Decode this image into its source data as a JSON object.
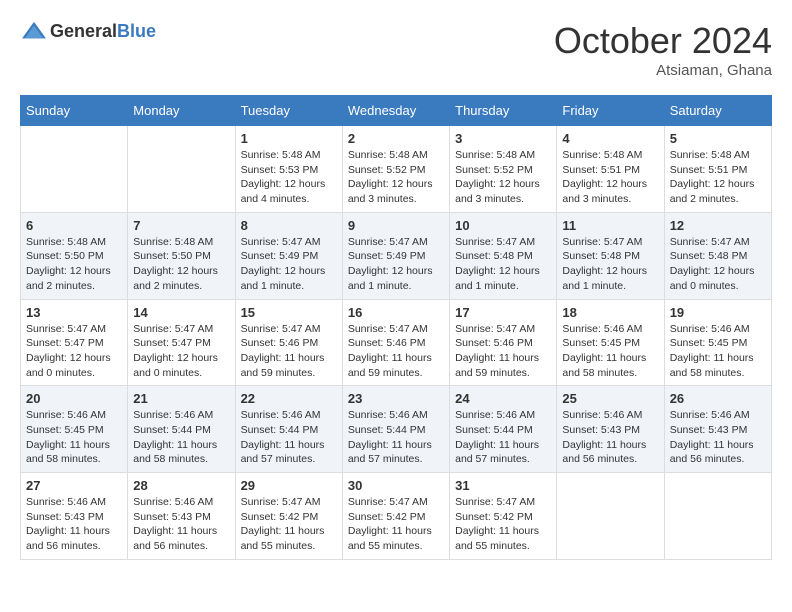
{
  "header": {
    "logo_general": "General",
    "logo_blue": "Blue",
    "month": "October 2024",
    "location": "Atsiaman, Ghana"
  },
  "weekdays": [
    "Sunday",
    "Monday",
    "Tuesday",
    "Wednesday",
    "Thursday",
    "Friday",
    "Saturday"
  ],
  "weeks": [
    [
      {
        "day": "",
        "info": ""
      },
      {
        "day": "",
        "info": ""
      },
      {
        "day": "1",
        "sunrise": "5:48 AM",
        "sunset": "5:53 PM",
        "daylight": "12 hours and 4 minutes."
      },
      {
        "day": "2",
        "sunrise": "5:48 AM",
        "sunset": "5:52 PM",
        "daylight": "12 hours and 3 minutes."
      },
      {
        "day": "3",
        "sunrise": "5:48 AM",
        "sunset": "5:52 PM",
        "daylight": "12 hours and 3 minutes."
      },
      {
        "day": "4",
        "sunrise": "5:48 AM",
        "sunset": "5:51 PM",
        "daylight": "12 hours and 3 minutes."
      },
      {
        "day": "5",
        "sunrise": "5:48 AM",
        "sunset": "5:51 PM",
        "daylight": "12 hours and 2 minutes."
      }
    ],
    [
      {
        "day": "6",
        "sunrise": "5:48 AM",
        "sunset": "5:50 PM",
        "daylight": "12 hours and 2 minutes."
      },
      {
        "day": "7",
        "sunrise": "5:48 AM",
        "sunset": "5:50 PM",
        "daylight": "12 hours and 2 minutes."
      },
      {
        "day": "8",
        "sunrise": "5:47 AM",
        "sunset": "5:49 PM",
        "daylight": "12 hours and 1 minute."
      },
      {
        "day": "9",
        "sunrise": "5:47 AM",
        "sunset": "5:49 PM",
        "daylight": "12 hours and 1 minute."
      },
      {
        "day": "10",
        "sunrise": "5:47 AM",
        "sunset": "5:48 PM",
        "daylight": "12 hours and 1 minute."
      },
      {
        "day": "11",
        "sunrise": "5:47 AM",
        "sunset": "5:48 PM",
        "daylight": "12 hours and 1 minute."
      },
      {
        "day": "12",
        "sunrise": "5:47 AM",
        "sunset": "5:48 PM",
        "daylight": "12 hours and 0 minutes."
      }
    ],
    [
      {
        "day": "13",
        "sunrise": "5:47 AM",
        "sunset": "5:47 PM",
        "daylight": "12 hours and 0 minutes."
      },
      {
        "day": "14",
        "sunrise": "5:47 AM",
        "sunset": "5:47 PM",
        "daylight": "12 hours and 0 minutes."
      },
      {
        "day": "15",
        "sunrise": "5:47 AM",
        "sunset": "5:46 PM",
        "daylight": "11 hours and 59 minutes."
      },
      {
        "day": "16",
        "sunrise": "5:47 AM",
        "sunset": "5:46 PM",
        "daylight": "11 hours and 59 minutes."
      },
      {
        "day": "17",
        "sunrise": "5:47 AM",
        "sunset": "5:46 PM",
        "daylight": "11 hours and 59 minutes."
      },
      {
        "day": "18",
        "sunrise": "5:46 AM",
        "sunset": "5:45 PM",
        "daylight": "11 hours and 58 minutes."
      },
      {
        "day": "19",
        "sunrise": "5:46 AM",
        "sunset": "5:45 PM",
        "daylight": "11 hours and 58 minutes."
      }
    ],
    [
      {
        "day": "20",
        "sunrise": "5:46 AM",
        "sunset": "5:45 PM",
        "daylight": "11 hours and 58 minutes."
      },
      {
        "day": "21",
        "sunrise": "5:46 AM",
        "sunset": "5:44 PM",
        "daylight": "11 hours and 58 minutes."
      },
      {
        "day": "22",
        "sunrise": "5:46 AM",
        "sunset": "5:44 PM",
        "daylight": "11 hours and 57 minutes."
      },
      {
        "day": "23",
        "sunrise": "5:46 AM",
        "sunset": "5:44 PM",
        "daylight": "11 hours and 57 minutes."
      },
      {
        "day": "24",
        "sunrise": "5:46 AM",
        "sunset": "5:44 PM",
        "daylight": "11 hours and 57 minutes."
      },
      {
        "day": "25",
        "sunrise": "5:46 AM",
        "sunset": "5:43 PM",
        "daylight": "11 hours and 56 minutes."
      },
      {
        "day": "26",
        "sunrise": "5:46 AM",
        "sunset": "5:43 PM",
        "daylight": "11 hours and 56 minutes."
      }
    ],
    [
      {
        "day": "27",
        "sunrise": "5:46 AM",
        "sunset": "5:43 PM",
        "daylight": "11 hours and 56 minutes."
      },
      {
        "day": "28",
        "sunrise": "5:46 AM",
        "sunset": "5:43 PM",
        "daylight": "11 hours and 56 minutes."
      },
      {
        "day": "29",
        "sunrise": "5:47 AM",
        "sunset": "5:42 PM",
        "daylight": "11 hours and 55 minutes."
      },
      {
        "day": "30",
        "sunrise": "5:47 AM",
        "sunset": "5:42 PM",
        "daylight": "11 hours and 55 minutes."
      },
      {
        "day": "31",
        "sunrise": "5:47 AM",
        "sunset": "5:42 PM",
        "daylight": "11 hours and 55 minutes."
      },
      {
        "day": "",
        "info": ""
      },
      {
        "day": "",
        "info": ""
      }
    ]
  ],
  "labels": {
    "sunrise_prefix": "Sunrise: ",
    "sunset_prefix": "Sunset: ",
    "daylight_prefix": "Daylight: "
  }
}
